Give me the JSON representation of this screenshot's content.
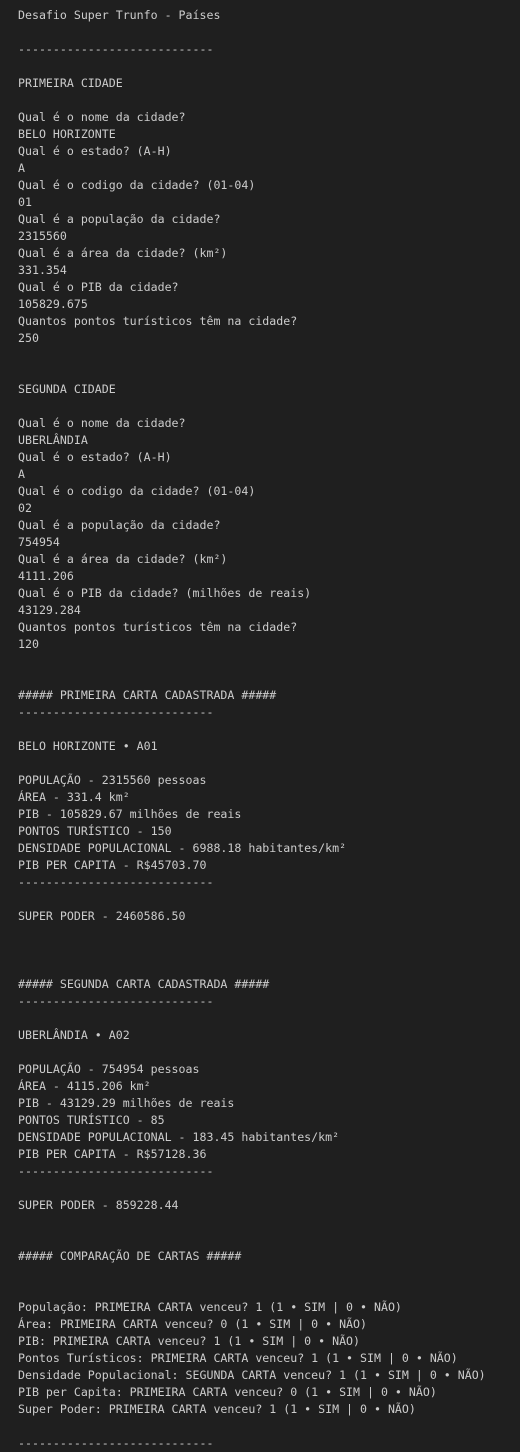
{
  "terminal": {
    "lines": [
      "Desafio Super Trunfo - Países",
      "",
      "----------------------------",
      "",
      "PRIMEIRA CIDADE",
      "",
      "Qual é o nome da cidade?",
      "BELO HORIZONTE",
      "Qual é o estado? (A-H)",
      "A",
      "Qual é o codigo da cidade? (01-04)",
      "01",
      "Qual é a população da cidade?",
      "2315560",
      "Qual é a área da cidade? (km²)",
      "331.354",
      "Qual é o PIB da cidade?",
      "105829.675",
      "Quantos pontos turísticos têm na cidade?",
      "250",
      "",
      "",
      "SEGUNDA CIDADE",
      "",
      "Qual é o nome da cidade?",
      "UBERLÂNDIA",
      "Qual é o estado? (A-H)",
      "A",
      "Qual é o codigo da cidade? (01-04)",
      "02",
      "Qual é a população da cidade?",
      "754954",
      "Qual é a área da cidade? (km²)",
      "4111.206",
      "Qual é o PIB da cidade? (milhões de reais)",
      "43129.284",
      "Quantos pontos turísticos têm na cidade?",
      "120",
      "",
      "",
      "##### PRIMEIRA CARTA CADASTRADA #####",
      "----------------------------",
      "",
      "BELO HORIZONTE • A01",
      "",
      "POPULAÇÃO - 2315560 pessoas",
      "ÁREA - 331.4 km²",
      "PIB - 105829.67 milhões de reais",
      "PONTOS TURÍSTICO - 150",
      "DENSIDADE POPULACIONAL - 6988.18 habitantes/km²",
      "PIB PER CAPITA - R$45703.70",
      "----------------------------",
      "",
      "SUPER PODER - 2460586.50",
      "",
      "",
      "",
      "##### SEGUNDA CARTA CADASTRADA #####",
      "----------------------------",
      "",
      "UBERLÂNDIA • A02",
      "",
      "POPULAÇÃO - 754954 pessoas",
      "ÁREA - 4115.206 km²",
      "PIB - 43129.29 milhões de reais",
      "PONTOS TURÍSTICO - 85",
      "DENSIDADE POPULACIONAL - 183.45 habitantes/km²",
      "PIB PER CAPITA - R$57128.36",
      "----------------------------",
      "",
      "SUPER PODER - 859228.44",
      "",
      "",
      "##### COMPARAÇÃO DE CARTAS #####",
      "",
      "",
      "População: PRIMEIRA CARTA venceu? 1 (1 • SIM | 0 • NÃO)",
      "Área: PRIMEIRA CARTA venceu? 0 (1 • SIM | 0 • NÃO)",
      "PIB: PRIMEIRA CARTA venceu? 1 (1 • SIM | 0 • NÃO)",
      "Pontos Turísticos: PRIMEIRA CARTA venceu? 1 (1 • SIM | 0 • NÃO)",
      "Densidade Populacional: SEGUNDA CARTA venceu? 1 (1 • SIM | 0 • NÃO)",
      "PIB per Capita: PRIMEIRA CARTA venceu? 0 (1 • SIM | 0 • NÃO)",
      "Super Poder: PRIMEIRA CARTA venceu? 1 (1 • SIM | 0 • NÃO)",
      "",
      "----------------------------"
    ]
  }
}
